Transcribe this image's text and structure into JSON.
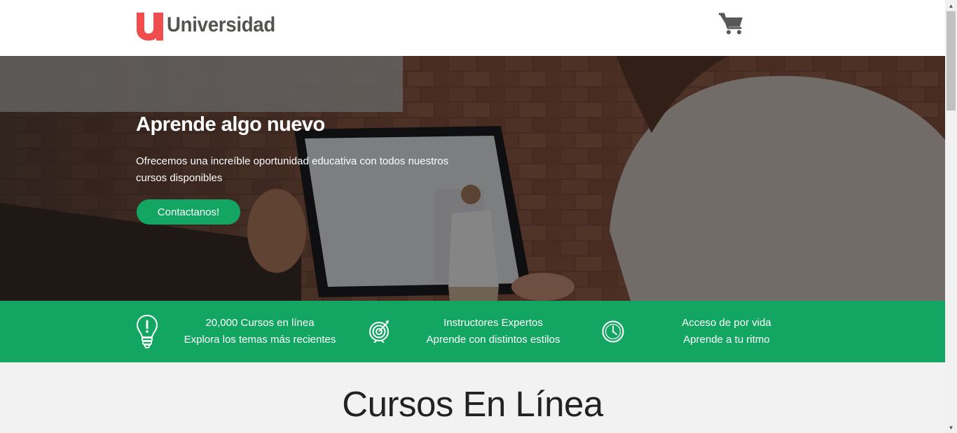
{
  "header": {
    "brand": "Universidad",
    "cart_icon": "shopping-cart-icon"
  },
  "hero": {
    "title": "Aprende algo nuevo",
    "text": "Ofrecemos una increíble oportunidad educativa con todos nuestros cursos disponibles",
    "button_label": "Contactanos!"
  },
  "features": [
    {
      "icon": "lightbulb-icon",
      "line1": "20,000 Cursos en línea",
      "line2": "Explora los temas más recientes"
    },
    {
      "icon": "target-icon",
      "line1": "Instructores Expertos",
      "line2": "Aprende con distintos estilos"
    },
    {
      "icon": "clock-icon",
      "line1": "Acceso de por vida",
      "line2": "Aprende a tu ritmo"
    }
  ],
  "courses": {
    "title": "Cursos En Línea"
  },
  "colors": {
    "brand_red": "#f04e4e",
    "accent_green": "#13a663",
    "logo_text": "#55524f"
  }
}
